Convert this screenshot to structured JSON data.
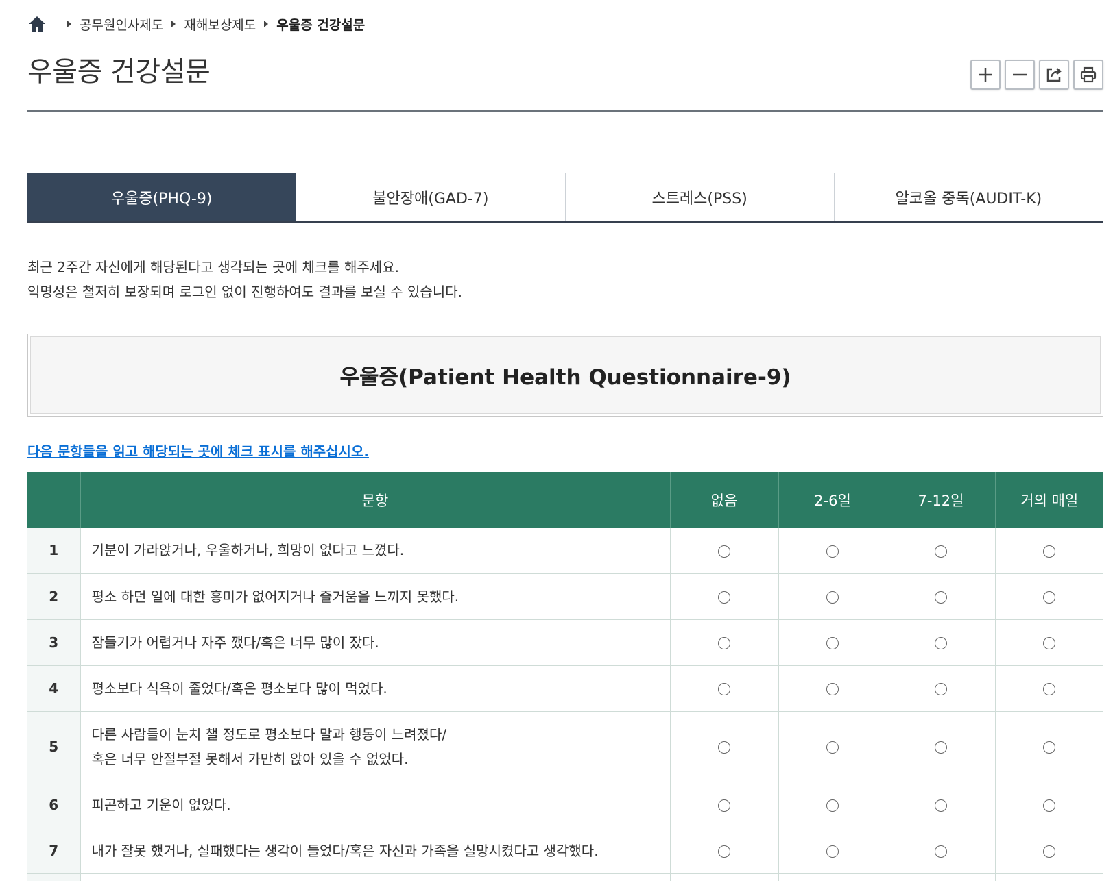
{
  "breadcrumb": {
    "items": [
      "공무원인사제도",
      "재해보상제도"
    ],
    "current": "우울증 건강설문"
  },
  "page": {
    "title": "우울증 건강설문"
  },
  "tabs": [
    {
      "label": "우울증(PHQ-9)",
      "active": true
    },
    {
      "label": "불안장애(GAD-7)",
      "active": false
    },
    {
      "label": "스트레스(PSS)",
      "active": false
    },
    {
      "label": "알코올 중독(AUDIT-K)",
      "active": false
    }
  ],
  "intro": {
    "line1": "최근 2주간 자신에게 해당된다고 생각되는 곳에 체크를 해주세요.",
    "line2": "익명성은 철저히 보장되며 로그인 없이 진행하여도 결과를 보실 수 있습니다."
  },
  "questionnaire": {
    "title": "우울증(Patient Health Questionnaire-9)",
    "instruction": "다음 문항들을 읽고 해당되는 곳에 체크 표시를 해주십시오."
  },
  "table": {
    "headers": {
      "number": "",
      "question": "문항",
      "opt1": "없음",
      "opt2": "2-6일",
      "opt3": "7-12일",
      "opt4": "거의 매일"
    },
    "rows": [
      {
        "num": "1",
        "line1": "기분이 가라앉거나, 우울하거나, 희망이 없다고 느꼈다.",
        "line2": ""
      },
      {
        "num": "2",
        "line1": "평소 하던 일에 대한 흥미가 없어지거나 즐거움을 느끼지 못했다.",
        "line2": ""
      },
      {
        "num": "3",
        "line1": "잠들기가 어렵거나 자주 깼다/혹은 너무 많이 잤다.",
        "line2": ""
      },
      {
        "num": "4",
        "line1": "평소보다 식욕이 줄었다/혹은 평소보다 많이 먹었다.",
        "line2": ""
      },
      {
        "num": "5",
        "line1": "다른 사람들이 눈치 챌 정도로 평소보다 말과 행동이 느려졌다/",
        "line2": "혹은 너무 안절부절 못해서 가만히 앉아 있을 수 없었다."
      },
      {
        "num": "6",
        "line1": "피곤하고 기운이 없었다.",
        "line2": ""
      },
      {
        "num": "7",
        "line1": "내가 잘못 했거나, 실패했다는 생각이 들었다/혹은 자신과 가족을 실망시켰다고 생각했다.",
        "line2": ""
      },
      {
        "num": "",
        "line1": "",
        "line2": ""
      }
    ]
  },
  "toolbar": {
    "icons": [
      "zoom-in-icon",
      "zoom-out-icon",
      "share-icon",
      "print-icon"
    ]
  },
  "colors": {
    "tab_active": "#36465a",
    "table_header": "#2b7b63",
    "instruction_link": "#0a6fd6"
  }
}
